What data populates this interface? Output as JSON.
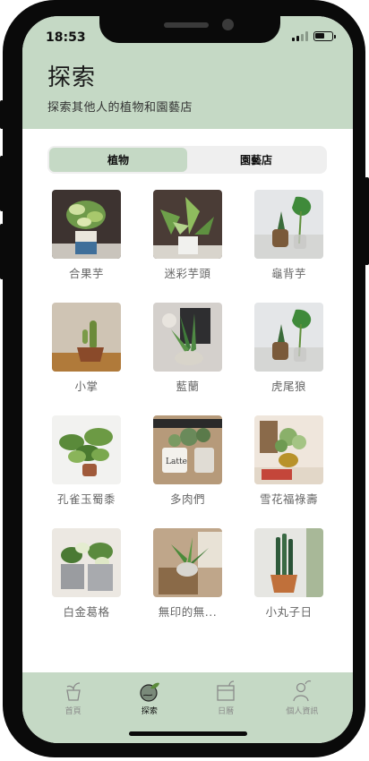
{
  "status": {
    "time": "18:53"
  },
  "header": {
    "title": "探索",
    "subtitle": "探索其他人的植物和園藝店"
  },
  "segments": [
    {
      "label": "植物",
      "active": true
    },
    {
      "label": "園藝店",
      "active": false
    }
  ],
  "plants": [
    {
      "label": "合果芋",
      "icon": "plant-photo"
    },
    {
      "label": "迷彩芋頭",
      "icon": "plant-photo"
    },
    {
      "label": "龜背芋",
      "icon": "plant-photo"
    },
    {
      "label": "小掌",
      "icon": "plant-photo"
    },
    {
      "label": "藍蘭",
      "icon": "plant-photo"
    },
    {
      "label": "虎尾狼",
      "icon": "plant-photo"
    },
    {
      "label": "孔雀玉蜀黍",
      "icon": "plant-photo"
    },
    {
      "label": "多肉們",
      "icon": "plant-photo"
    },
    {
      "label": "雪花福祿壽",
      "icon": "plant-photo"
    },
    {
      "label": "白金葛格",
      "icon": "plant-photo"
    },
    {
      "label": "無印的無...",
      "icon": "plant-photo"
    },
    {
      "label": "小丸子日",
      "icon": "plant-photo"
    }
  ],
  "tabs": [
    {
      "label": "首頁",
      "icon": "pot-icon",
      "active": false
    },
    {
      "label": "探索",
      "icon": "globe-plant-icon",
      "active": true
    },
    {
      "label": "日曆",
      "icon": "calendar-plant-icon",
      "active": false
    },
    {
      "label": "個人資訊",
      "icon": "person-sprout-icon",
      "active": false
    }
  ],
  "colors": {
    "accent": "#c5d9c5",
    "frame": "#0a0a0a",
    "label_gray": "#666666"
  }
}
